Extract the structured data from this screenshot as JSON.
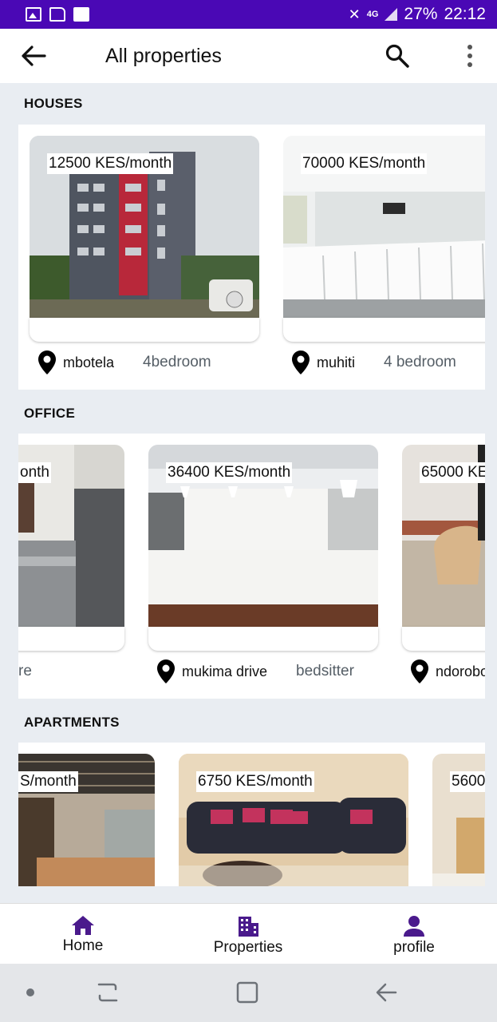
{
  "status_bar": {
    "battery": "27%",
    "time": "22:12",
    "network": "4G"
  },
  "app_bar": {
    "title": "All properties"
  },
  "sections": [
    {
      "title": "HOUSES",
      "cards": [
        {
          "price": "12500 KES/month",
          "location": "mbotela",
          "bedrooms": "4bedroom",
          "image": "building-exterior"
        },
        {
          "price": "70000 KES/month",
          "location": "muhiti",
          "bedrooms": "4 bedroom",
          "image": "reception-desk"
        }
      ]
    },
    {
      "title": "OFFICE",
      "cards": [
        {
          "price": "onth",
          "location": "",
          "bedrooms": "re",
          "image": "laundry-room"
        },
        {
          "price": "36400 KES/month",
          "location": "mukima drive",
          "bedrooms": "bedsitter",
          "image": "office-reception"
        },
        {
          "price": "65000 KE",
          "location": "ndorobo",
          "bedrooms": "",
          "image": "chair-table"
        }
      ]
    },
    {
      "title": "APARTMENTS",
      "cards": [
        {
          "price": "S/month",
          "image": "luxury-living-room"
        },
        {
          "price": "6750 KES/month",
          "image": "leather-sofas"
        },
        {
          "price": "5600",
          "image": "apartment-interior"
        }
      ]
    }
  ],
  "bottom_nav": {
    "home": "Home",
    "properties": "Properties",
    "profile": "profile"
  },
  "colors": {
    "status_bar": "#4a08b5",
    "nav_icon": "#4a1a8c",
    "background": "#e9edf2"
  }
}
